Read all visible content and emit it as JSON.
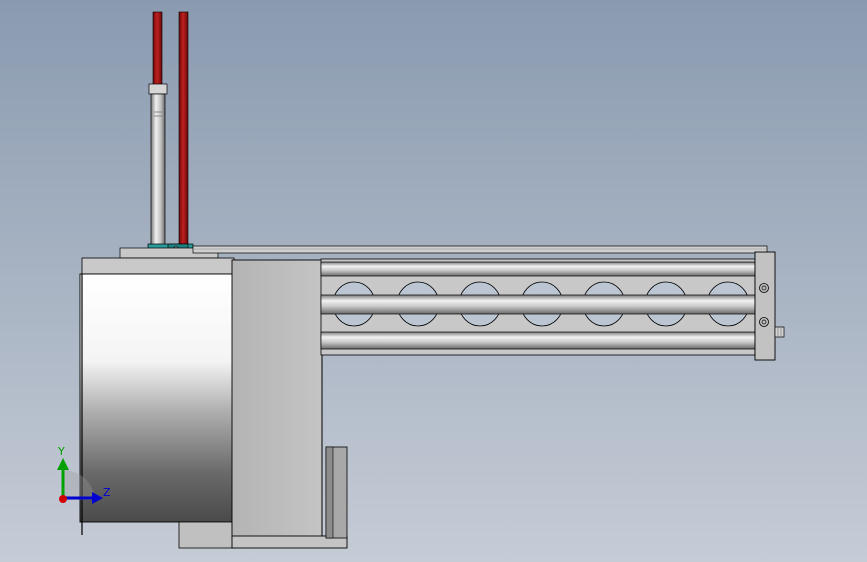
{
  "viewport": {
    "background_top": "#8a9bb0",
    "background_bottom": "#c6ccd6"
  },
  "colors": {
    "metal_light": "#e8e8e8",
    "metal_mid": "#b8b8b8",
    "metal_dark": "#6e6e6e",
    "housing_dark": "#4a4a4a",
    "plate_grey": "#bdbdbd",
    "tube_red": "#a01818",
    "fitting_teal": "#2a9a9a",
    "outline": "#000000",
    "axis_y": "#00a000",
    "axis_z": "#0000d0",
    "axis_origin": "#d00000"
  },
  "triad": {
    "y_label": "Y",
    "z_label": "Z"
  }
}
